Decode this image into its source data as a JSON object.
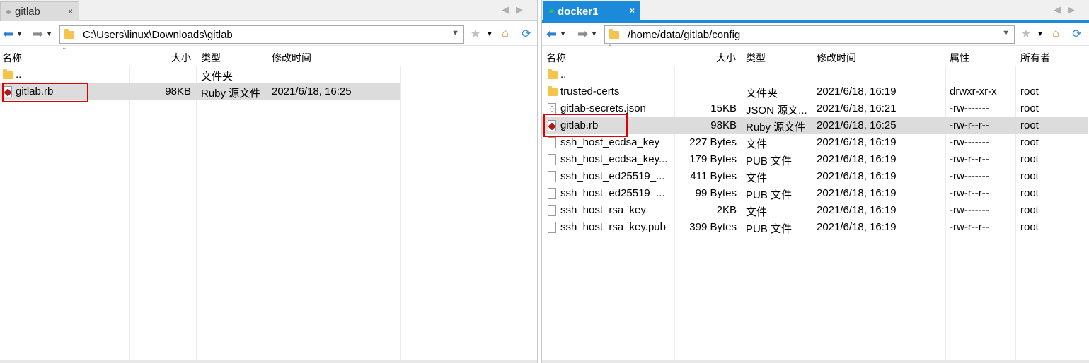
{
  "left": {
    "tab": {
      "label": "gitlab",
      "close": "×"
    },
    "path": "C:\\Users\\linux\\Downloads\\gitlab",
    "columns": {
      "name": "名称",
      "size": "大小",
      "type": "类型",
      "modified": "修改时间"
    },
    "rows": [
      {
        "name": "..",
        "size": "",
        "type": "文件夹",
        "modified": "",
        "icon": "folder-icon"
      },
      {
        "name": "gitlab.rb",
        "size": "98KB",
        "type": "Ruby 源文件",
        "modified": "2021/6/18, 16:25",
        "icon": "ruby-file-icon",
        "selected": true
      }
    ]
  },
  "right": {
    "tab": {
      "label": "docker1",
      "close": "×",
      "status_color": "#22c55e"
    },
    "path": "/home/data/gitlab/config",
    "columns": {
      "name": "名称",
      "size": "大小",
      "type": "类型",
      "modified": "修改时间",
      "attrs": "属性",
      "owner": "所有者"
    },
    "rows": [
      {
        "name": "..",
        "size": "",
        "type": "",
        "modified": "",
        "attrs": "",
        "owner": "",
        "icon": "folder-icon"
      },
      {
        "name": "trusted-certs",
        "size": "",
        "type": "文件夹",
        "modified": "2021/6/18, 16:19",
        "attrs": "drwxr-xr-x",
        "owner": "root",
        "icon": "folder-icon"
      },
      {
        "name": "gitlab-secrets.json",
        "size": "15KB",
        "type": "JSON 源文...",
        "modified": "2021/6/18, 16:21",
        "attrs": "-rw-------",
        "owner": "root",
        "icon": "json-file-icon"
      },
      {
        "name": "gitlab.rb",
        "size": "98KB",
        "type": "Ruby 源文件",
        "modified": "2021/6/18, 16:25",
        "attrs": "-rw-r--r--",
        "owner": "root",
        "icon": "ruby-file-icon",
        "selected": true
      },
      {
        "name": "ssh_host_ecdsa_key",
        "size": "227 Bytes",
        "type": "文件",
        "modified": "2021/6/18, 16:19",
        "attrs": "-rw-------",
        "owner": "root",
        "icon": "file-icon"
      },
      {
        "name": "ssh_host_ecdsa_key...",
        "size": "179 Bytes",
        "type": "PUB 文件",
        "modified": "2021/6/18, 16:19",
        "attrs": "-rw-r--r--",
        "owner": "root",
        "icon": "file-icon"
      },
      {
        "name": "ssh_host_ed25519_...",
        "size": "411 Bytes",
        "type": "文件",
        "modified": "2021/6/18, 16:19",
        "attrs": "-rw-------",
        "owner": "root",
        "icon": "file-icon"
      },
      {
        "name": "ssh_host_ed25519_...",
        "size": "99 Bytes",
        "type": "PUB 文件",
        "modified": "2021/6/18, 16:19",
        "attrs": "-rw-r--r--",
        "owner": "root",
        "icon": "file-icon"
      },
      {
        "name": "ssh_host_rsa_key",
        "size": "2KB",
        "type": "文件",
        "modified": "2021/6/18, 16:19",
        "attrs": "-rw-------",
        "owner": "root",
        "icon": "file-icon"
      },
      {
        "name": "ssh_host_rsa_key.pub",
        "size": "399 Bytes",
        "type": "PUB 文件",
        "modified": "2021/6/18, 16:19",
        "attrs": "-rw-r--r--",
        "owner": "root",
        "icon": "file-icon"
      }
    ]
  },
  "colors": {
    "accent": "#1b8ad8",
    "highlight_box": "#e00000",
    "selected_row": "#dcdcdc"
  }
}
